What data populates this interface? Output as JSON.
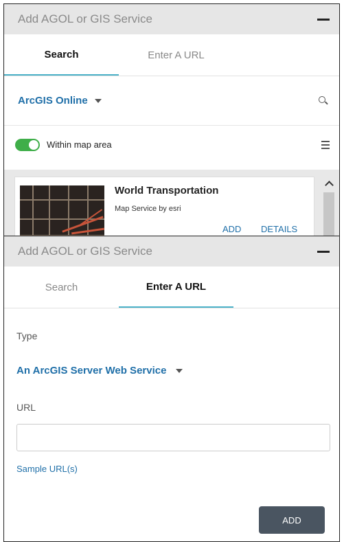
{
  "panel1": {
    "title": "Add AGOL or GIS Service",
    "tabs": [
      {
        "label": "Search",
        "active": true
      },
      {
        "label": "Enter A URL",
        "active": false
      }
    ],
    "source": "ArcGIS Online",
    "filter_label": "Within map area",
    "filter_on": true,
    "result": {
      "title": "World Transportation",
      "subtitle": "Map Service by esri",
      "add_label": "ADD",
      "details_label": "DETAILS"
    }
  },
  "panel2": {
    "title": "Add AGOL or GIS Service",
    "tabs": [
      {
        "label": "Search",
        "active": false
      },
      {
        "label": "Enter A URL",
        "active": true
      }
    ],
    "type_label": "Type",
    "type_value": "An ArcGIS Server Web Service",
    "url_label": "URL",
    "url_value": "",
    "sample_link": "Sample URL(s)",
    "add_button": "ADD"
  },
  "colors": {
    "accent": "#4bb1c8",
    "link": "#1f6fa8",
    "toggle_on": "#3fae49",
    "button": "#4a5561",
    "titlebar": "#e6e6e6"
  }
}
